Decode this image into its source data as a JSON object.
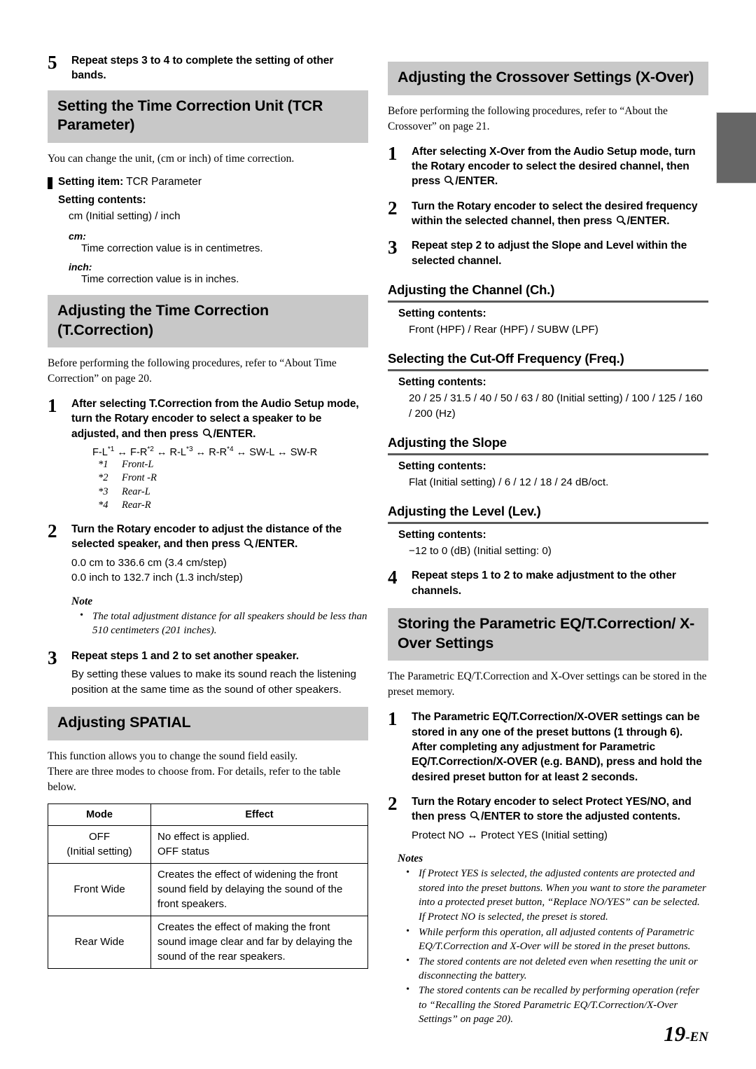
{
  "page": {
    "folio_number": "19",
    "folio_suffix": "-EN"
  },
  "icons": {
    "enter": "magnifier-icon"
  },
  "left": {
    "step5": {
      "num": "5",
      "text": "Repeat steps 3 to 4 to complete the setting of other bands."
    },
    "tcr_section": {
      "heading": "Setting the Time Correction Unit (TCR Parameter)",
      "intro": "You can change the unit, (cm or inch) of time correction.",
      "setting_item_label": "Setting item:",
      "setting_item_value": "TCR Parameter",
      "setting_contents_label": "Setting contents:",
      "setting_contents_value": "cm (Initial setting) / inch",
      "defs": [
        {
          "term": "cm:",
          "desc": "Time correction value is in centimetres."
        },
        {
          "term": "inch:",
          "desc": "Time correction value is in inches."
        }
      ]
    },
    "tcorrection_section": {
      "heading": "Adjusting the Time Correction (T.Correction)",
      "intro": "Before performing the following procedures, refer to “About Time Correction” on page 20.",
      "step1": {
        "num": "1",
        "text_a": "After selecting T.Correction from the Audio Setup mode, turn the ",
        "bold_rotary": "Rotary encoder",
        "text_b": " to select a speaker to be adjusted, and then press ",
        "text_c": "/ENTER.",
        "sequence": "F-L*1 ↔ F-R*2 ↔ R-L*3 ↔ R-R*4 ↔ SW-L ↔ SW-R",
        "footnotes": [
          {
            "mark": "*1",
            "text": "Front-L"
          },
          {
            "mark": "*2",
            "text": "Front -R"
          },
          {
            "mark": "*3",
            "text": "Rear-L"
          },
          {
            "mark": "*4",
            "text": "Rear-R"
          }
        ]
      },
      "step2": {
        "num": "2",
        "text_a": "Turn the ",
        "bold_rotary": "Rotary encoder",
        "text_b": " to adjust the distance of the selected speaker, and then press ",
        "text_c": "/ENTER.",
        "range_cm": "0.0 cm to 336.6 cm (3.4 cm/step)",
        "range_inch": "0.0 inch to 132.7 inch (1.3 inch/step)",
        "note_title": "Note",
        "notes": [
          "The total adjustment distance for all speakers should be less than 510 centimeters (201 inches)."
        ]
      },
      "step3": {
        "num": "3",
        "text": "Repeat steps 1 and 2 to set another speaker.",
        "sub": "By setting these values to make its sound reach the listening position at the same time as the sound of other speakers."
      }
    },
    "spatial_section": {
      "heading": "Adjusting SPATIAL",
      "intro_line1": "This function allows you to change the sound field easily.",
      "intro_line2": "There are three modes to choose from. For details, refer to the table below.",
      "table": {
        "headers": [
          "Mode",
          "Effect"
        ],
        "rows": [
          {
            "mode": "OFF\n(Initial setting)",
            "effect": "No effect is applied.\nOFF status"
          },
          {
            "mode": "Front Wide",
            "effect": "Creates the effect of widening the front sound field by delaying the sound of the front speakers."
          },
          {
            "mode": "Rear Wide",
            "effect": "Creates the effect of making the front sound image clear and far by delaying the sound of the rear speakers."
          }
        ]
      }
    }
  },
  "right": {
    "xover_section": {
      "heading": "Adjusting the Crossover Settings (X-Over)",
      "intro": "Before performing the following procedures, refer to “About the Crossover” on page 21.",
      "step1": {
        "num": "1",
        "text_a": "After selecting X-Over from the Audio Setup mode, turn the ",
        "bold_rotary": "Rotary encoder",
        "text_b": " to select the desired channel, then press ",
        "text_c": "/ENTER."
      },
      "step2": {
        "num": "2",
        "text_a": "Turn the ",
        "bold_rotary": "Rotary encoder",
        "text_b": " to select the desired frequency within the selected channel, then press ",
        "text_c": "/ENTER."
      },
      "step3": {
        "num": "3",
        "text": "Repeat step 2 to adjust the Slope and Level within the selected channel."
      },
      "subsections": [
        {
          "heading": "Adjusting the Channel (Ch.)",
          "contents_label": "Setting contents:",
          "contents_value": "Front (HPF) / Rear (HPF) / SUBW (LPF)"
        },
        {
          "heading": "Selecting the Cut-Off Frequency (Freq.)",
          "contents_label": "Setting contents:",
          "contents_value": "20 / 25 / 31.5 / 40 / 50 / 63 / 80 (Initial setting) / 100 / 125 / 160 / 200 (Hz)"
        },
        {
          "heading": "Adjusting the Slope",
          "contents_label": "Setting contents:",
          "contents_value": "Flat (Initial setting) / 6 / 12 / 18 / 24 dB/oct."
        },
        {
          "heading": "Adjusting the Level (Lev.)",
          "contents_label": "Setting contents:",
          "contents_value": "−12 to 0 (dB) (Initial setting: 0)"
        }
      ],
      "step4": {
        "num": "4",
        "text": "Repeat steps 1 to 2 to make adjustment to the other channels."
      }
    },
    "storing_section": {
      "heading": "Storing the Parametric EQ/T.Correction/ X-Over Settings",
      "intro": "The Parametric EQ/T.Correction and X-Over settings can be stored in the preset memory.",
      "step1": {
        "num": "1",
        "text_a": "The Parametric EQ/T.Correction/X-OVER settings can be stored in any one of the ",
        "bold_preset": "preset buttons",
        "text_b": " (",
        "bold_range": "1 through 6",
        "text_c": "). After completing any adjustment for Parametric EQ/T.Correction/X-OVER (e.g. BAND), press and hold the desired preset button for at least 2 seconds."
      },
      "step2": {
        "num": "2",
        "text_a": "Turn the ",
        "bold_rotary": "Rotary encoder",
        "text_b": " to select Protect YES/NO, and then press ",
        "text_c": "/ENTER",
        "text_d": " to store the adjusted contents.",
        "sub": "Protect NO ↔ Protect YES (Initial setting)"
      },
      "notes_title": "Notes",
      "notes": [
        {
          "bullet": true,
          "text": "If Protect YES is selected, the adjusted contents are protected and stored into the preset buttons. When you want to store the parameter into a protected preset button, “Replace NO/YES” can be selected."
        },
        {
          "bullet": false,
          "text": "If Protect NO is selected, the preset is stored."
        },
        {
          "bullet": true,
          "text": "While perform this operation, all adjusted contents of Parametric EQ/T.Correction and X-Over will be stored in the preset buttons."
        },
        {
          "bullet": true,
          "text": "The stored contents are not deleted even when resetting the unit or disconnecting the battery."
        },
        {
          "bullet": true,
          "text": "The stored contents can be recalled by performing operation (refer to “Recalling the Stored Parametric EQ/T.Correction/X-Over Settings” on page 20)."
        }
      ]
    }
  }
}
